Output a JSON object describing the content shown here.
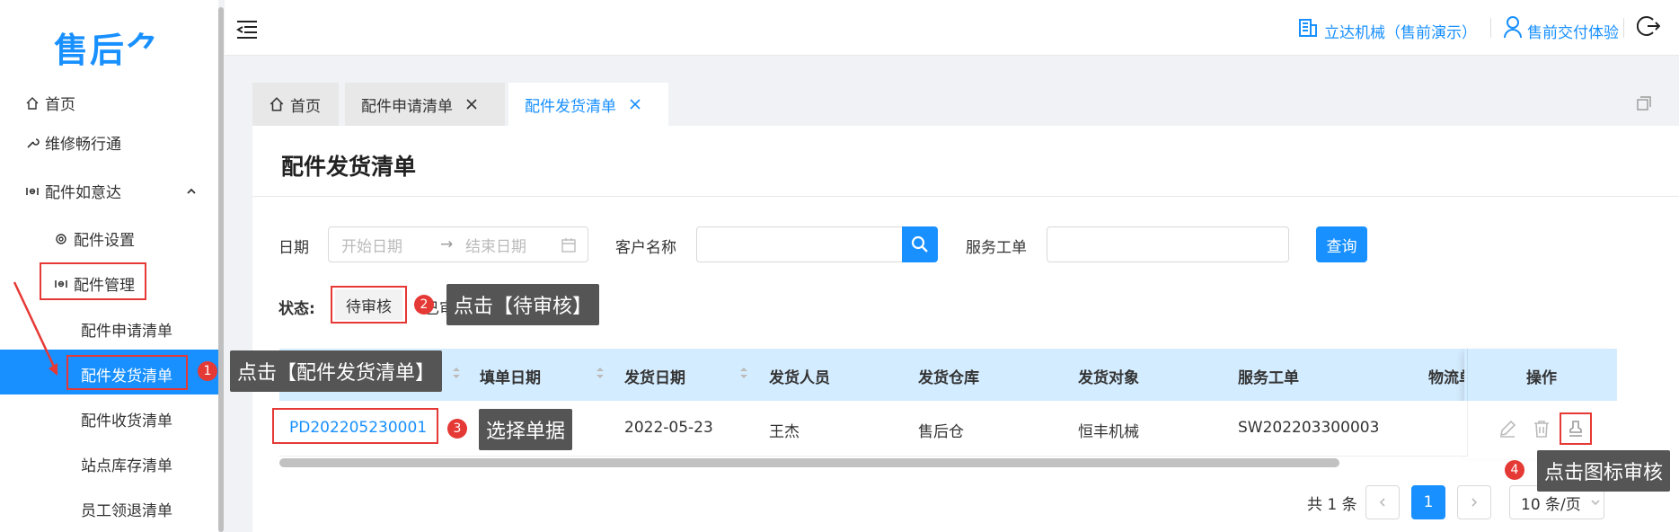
{
  "app": {
    "logo_text": "售后⺈"
  },
  "sidebar": {
    "items": [
      {
        "label": "首页"
      },
      {
        "label": "维修畅行通"
      },
      {
        "label": "配件如意达"
      },
      {
        "label": "配件设置"
      },
      {
        "label": "配件管理"
      },
      {
        "label": "配件申请清单"
      },
      {
        "label": "配件发货清单"
      },
      {
        "label": "配件收货清单"
      },
      {
        "label": "站点库存清单"
      },
      {
        "label": "员工领退清单"
      }
    ]
  },
  "header": {
    "company": "立达机械（售前演示）",
    "user": "售前交付体验"
  },
  "tabs": [
    {
      "label": "首页"
    },
    {
      "label": "配件申请清单"
    },
    {
      "label": "配件发货清单"
    }
  ],
  "page": {
    "title": "配件发货清单",
    "filters": {
      "date_label": "日期",
      "start_placeholder": "开始日期",
      "arrow": "→",
      "end_placeholder": "结束日期",
      "customer_label": "客户名称",
      "customer_value": "",
      "service_label": "服务工单",
      "service_value": "",
      "query_label": "查询",
      "status_label": "状态:",
      "status_option": "待审核",
      "status_option_partial": "已审"
    },
    "table": {
      "columns": [
        "填单日期",
        "发货日期",
        "发货人员",
        "发货仓库",
        "发货对象",
        "服务工单",
        "物流单",
        "操作"
      ],
      "rows": [
        {
          "order_no": "PD202205230001",
          "ship_date": "2022-05-23",
          "shipper": "王杰",
          "warehouse": "售后仓",
          "target": "恒丰机械",
          "service_order": "SW202203300003"
        }
      ]
    },
    "pagination": {
      "total": "共 1 条",
      "current": "1",
      "page_size": "10 条/页"
    }
  },
  "annotations": [
    {
      "num": "1",
      "text": "点击【配件发货清单】"
    },
    {
      "num": "2",
      "text": "点击【待审核】"
    },
    {
      "num": "3",
      "text": "选择单据"
    },
    {
      "num": "4",
      "text": "点击图标审核"
    }
  ],
  "colors": {
    "primary": "#1890ff",
    "annotation_red": "#e53935",
    "callout_bg": "#555555"
  }
}
